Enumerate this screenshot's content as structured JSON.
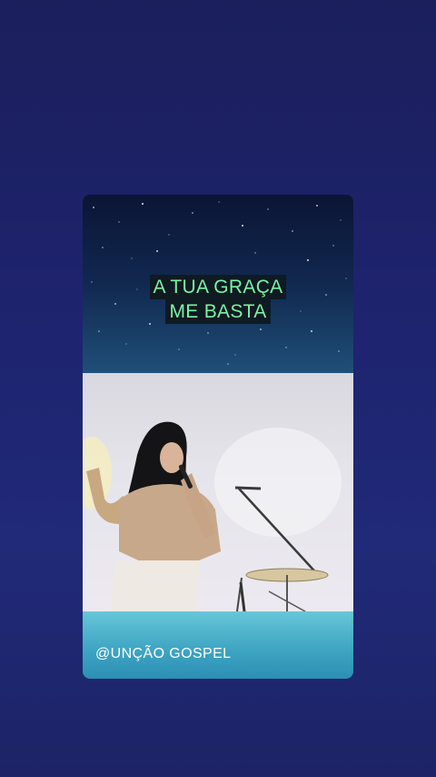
{
  "caption": {
    "line1": "A TUA GRAÇA",
    "line2": "ME BASTA"
  },
  "watermark": {
    "handle": "@UNÇÃO GOSPEL"
  },
  "colors": {
    "background": "#1e2470",
    "caption_text": "#7cf2a4",
    "caption_bg": "#0f1a22",
    "footer_band": "#3fa6c3"
  }
}
